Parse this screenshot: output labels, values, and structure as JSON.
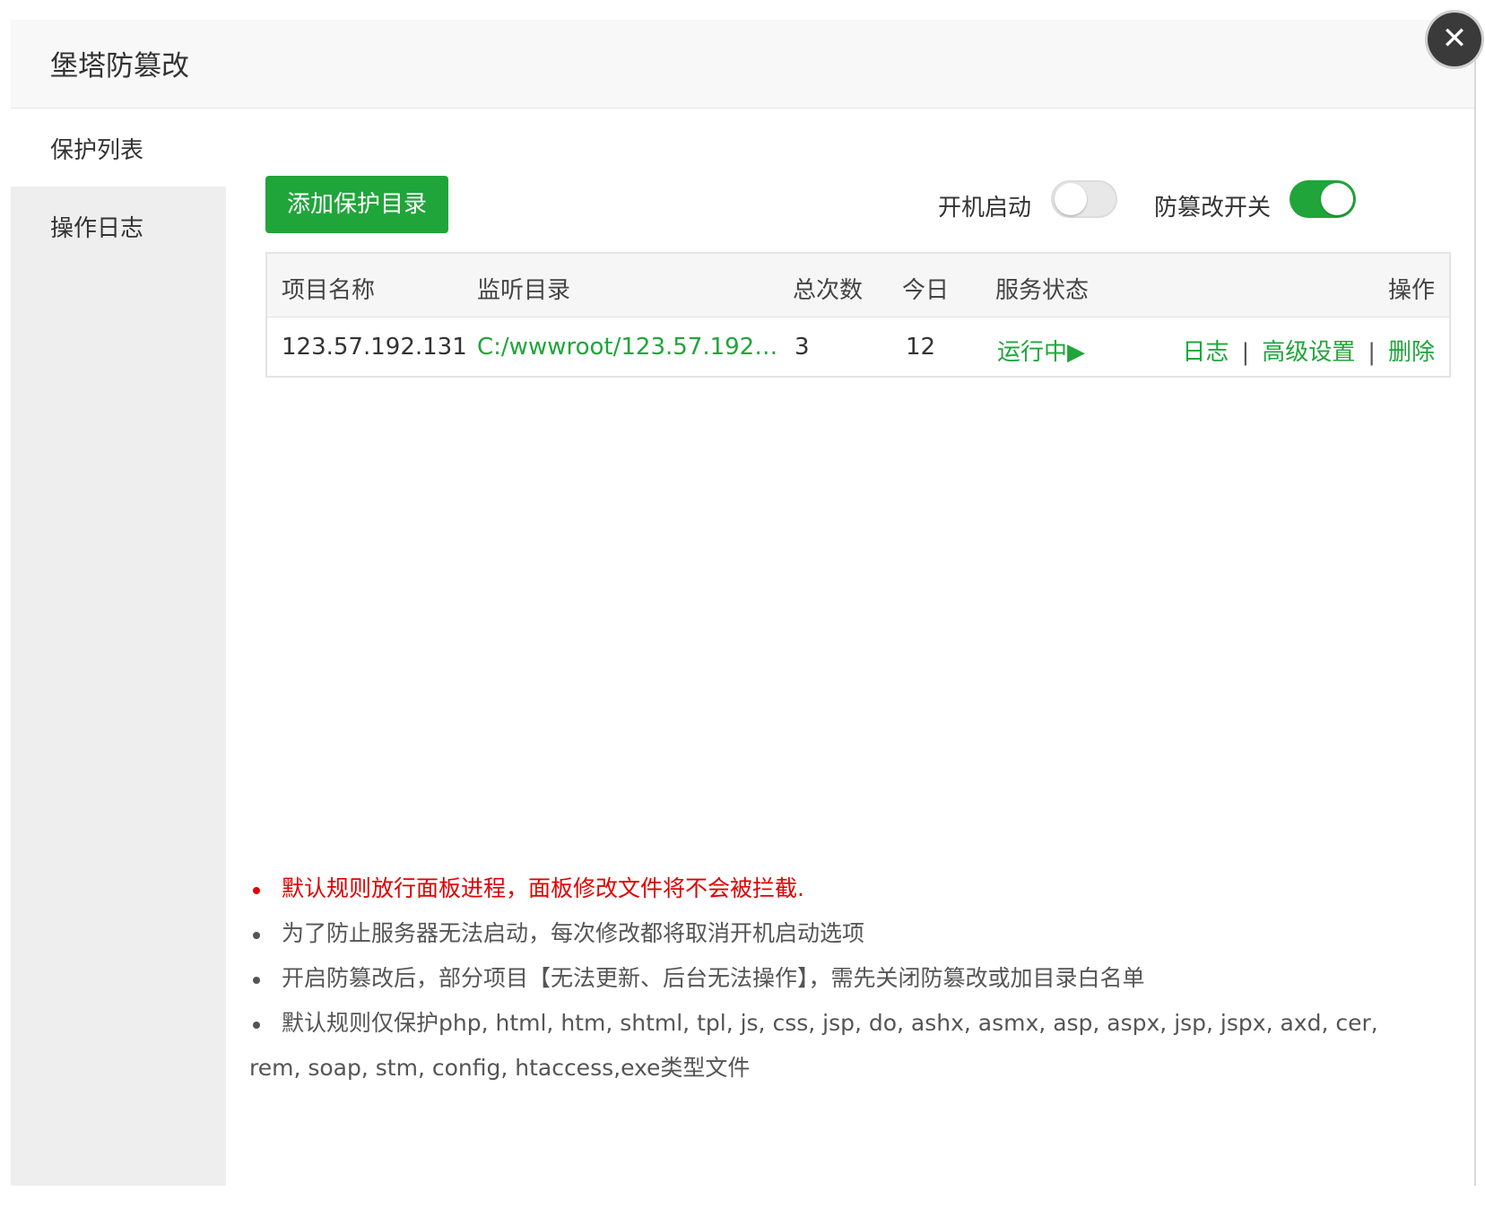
{
  "dialog": {
    "title": "堡塔防篡改",
    "close_glyph": "✕"
  },
  "sidebar": {
    "items": [
      {
        "label": "保护列表",
        "active": true
      },
      {
        "label": "操作日志",
        "active": false
      }
    ]
  },
  "toolbar": {
    "add_button": "添加保护目录",
    "boot_start": {
      "label": "开机启动",
      "on": false
    },
    "tamper_switch": {
      "label": "防篡改开关",
      "on": true
    }
  },
  "table": {
    "headers": [
      "项目名称",
      "监听目录",
      "总次数",
      "今日",
      "服务状态",
      "操作"
    ],
    "rows": [
      {
        "name": "123.57.192.131",
        "path": "C:/wwwroot/123.57.192…",
        "total": "3",
        "today": "12",
        "status": "运行中",
        "status_icon": "▶",
        "actions": {
          "log": "日志",
          "sep1": "|",
          "advanced": "高级设置",
          "sep2": "|",
          "delete": "删除"
        }
      }
    ]
  },
  "notes": [
    "默认规则放行面板进程，面板修改文件将不会被拦截.",
    "为了防止服务器无法启动，每次修改都将取消开机启动选项",
    "开启防篡改后，部分项目【无法更新、后台无法操作】，需先关闭防篡改或加目录白名单",
    "默认规则仅保护php, html, htm, shtml, tpl, js, css, jsp, do, ashx, asmx, asp, aspx, jsp, jspx, axd, cer, rem, soap, stm, config, htaccess,exe类型文件"
  ],
  "colors": {
    "accent": "#20a53a",
    "warning": "#e00000"
  }
}
